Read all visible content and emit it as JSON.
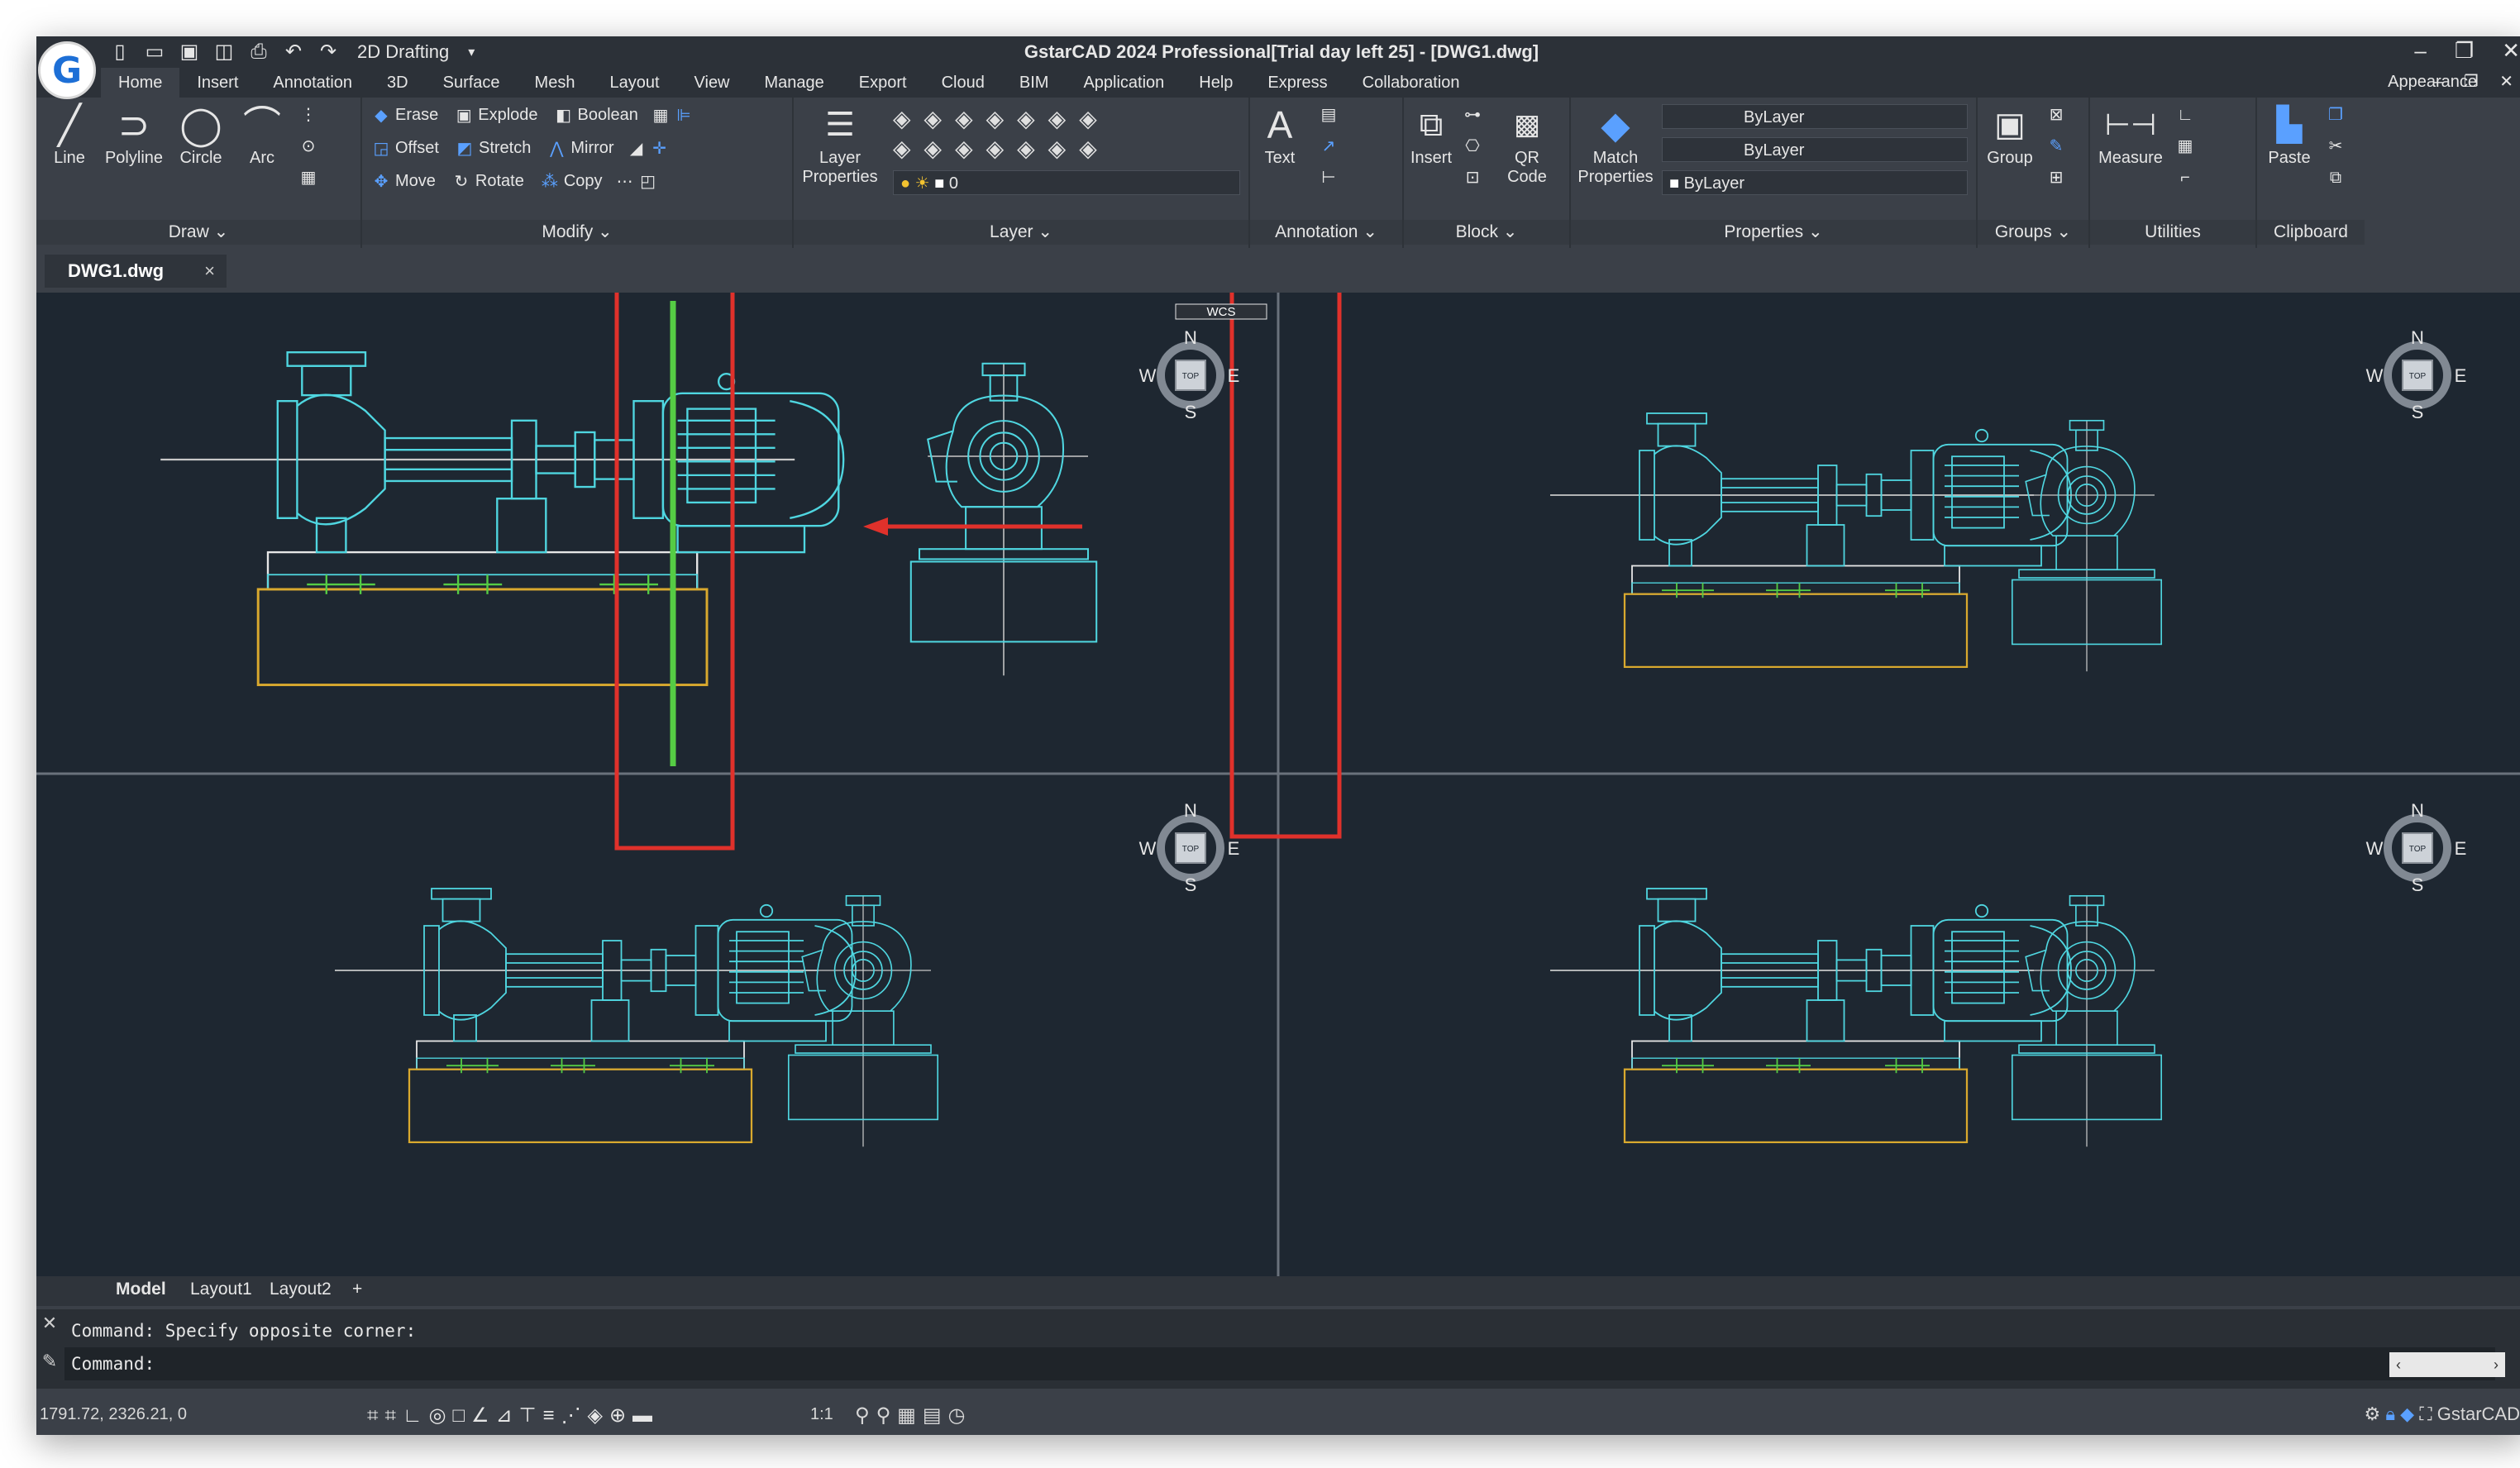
{
  "app": {
    "title": "GstarCAD 2024 Professional[Trial day left 25] - [DWG1.dwg]",
    "workspace": "2D Drafting",
    "appearance": "Appearance"
  },
  "menu": [
    "Home",
    "Insert",
    "Annotation",
    "3D",
    "Surface",
    "Mesh",
    "Layout",
    "View",
    "Manage",
    "Export",
    "Cloud",
    "BIM",
    "Application",
    "Help",
    "Express",
    "Collaboration"
  ],
  "ribbon": {
    "draw": {
      "label": "Draw",
      "tools": [
        "Line",
        "Polyline",
        "Circle",
        "Arc"
      ]
    },
    "modify": {
      "label": "Modify",
      "row1": [
        "Erase",
        "Explode",
        "Boolean"
      ],
      "row2": [
        "Offset",
        "Stretch",
        "Mirror"
      ],
      "row3": [
        "Move",
        "Rotate",
        "Copy"
      ]
    },
    "layer": {
      "label": "Layer",
      "properties": "Layer\nProperties",
      "layer_line1": "Layer",
      "layer_line2": "Properties",
      "current": "0"
    },
    "annotation": {
      "label": "Annotation",
      "text": "Text"
    },
    "block": {
      "label": "Block",
      "insert": "Insert",
      "qr1": "QR",
      "qr2": "Code"
    },
    "properties": {
      "label": "Properties",
      "match1": "Match",
      "match2": "Properties",
      "bylayer1": "ByLayer",
      "bylayer2": "ByLayer",
      "bylayer3": "ByLayer"
    },
    "groups": {
      "label": "Groups",
      "group": "Group"
    },
    "utilities": {
      "label": "Utilities",
      "measure": "Measure"
    },
    "clipboard": {
      "label": "Clipboard",
      "paste": "Paste"
    }
  },
  "doc_tab": {
    "name": "DWG1.dwg",
    "close": "×"
  },
  "viewport": {
    "top_label": "WCS",
    "compass": {
      "n": "N",
      "s": "S",
      "e": "E",
      "w": "W",
      "top": "TOP"
    }
  },
  "layout_tabs": [
    "Model",
    "Layout1",
    "Layout2",
    "+"
  ],
  "command": {
    "history": "Command: Specify opposite corner:",
    "prompt": "Command:"
  },
  "status": {
    "coords": "1791.72, 2326.21, 0",
    "scale": "1:1",
    "app_name": "GstarCAD"
  },
  "colors": {
    "highlight": "#e0312b",
    "cyan": "#4fd6e0",
    "green": "#55cc44",
    "yellow": "#d9a92e",
    "red_arrow": "#e0312b"
  }
}
